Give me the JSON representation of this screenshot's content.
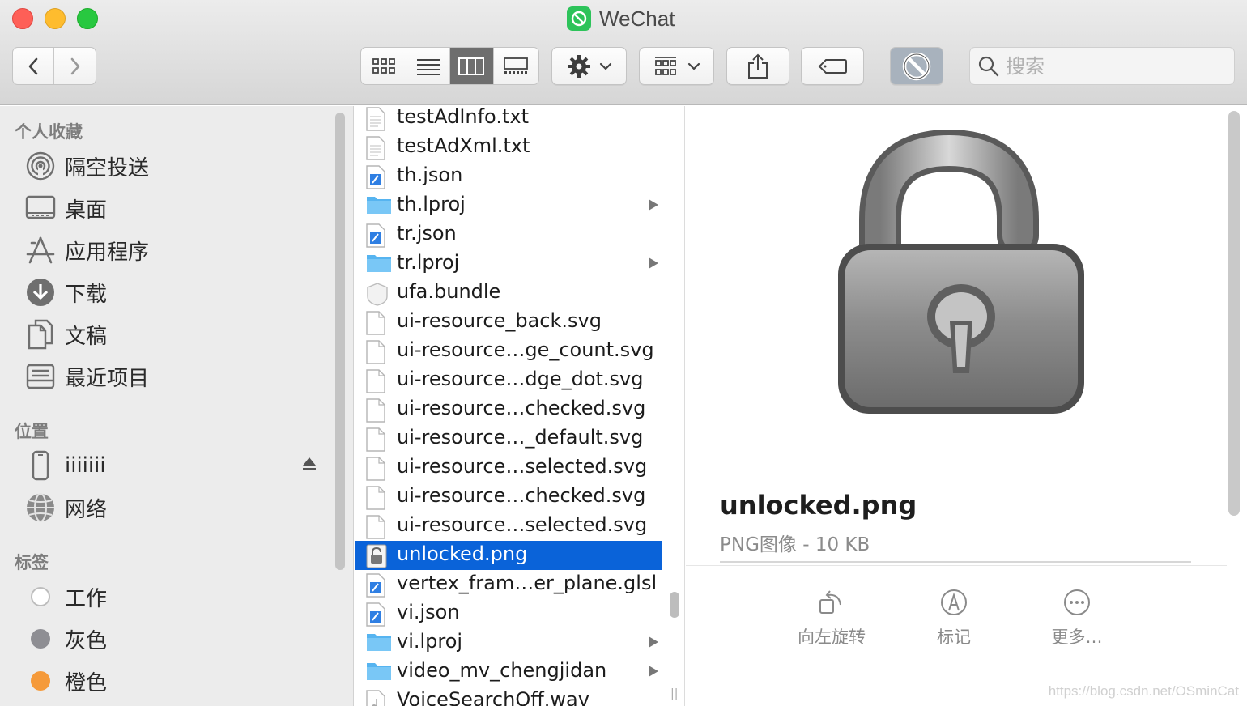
{
  "window": {
    "title": "WeChat",
    "accent": "#0a63d9"
  },
  "toolbar": {
    "back_icon": "chevron-left-icon",
    "forward_icon": "chevron-right-icon",
    "views": [
      "icon-view",
      "list-view",
      "column-view",
      "gallery-view"
    ],
    "active_view": "column-view",
    "search_placeholder": "搜索"
  },
  "sidebar": {
    "favorites_heading": "个人收藏",
    "favorites": [
      {
        "label": "隔空投送",
        "icon": "airdrop-icon"
      },
      {
        "label": "桌面",
        "icon": "desktop-icon"
      },
      {
        "label": "应用程序",
        "icon": "applications-icon"
      },
      {
        "label": "下载",
        "icon": "downloads-icon"
      },
      {
        "label": "文稿",
        "icon": "documents-icon"
      },
      {
        "label": "最近项目",
        "icon": "recents-icon"
      }
    ],
    "locations_heading": "位置",
    "locations": [
      {
        "label": "iiiiiii",
        "icon": "iphone-icon"
      },
      {
        "label": "网络",
        "icon": "network-icon"
      }
    ],
    "tags_heading": "标签",
    "tags": [
      {
        "label": "工作",
        "color": "#ffffff"
      },
      {
        "label": "灰色",
        "color": "#8e8e93"
      },
      {
        "label": "橙色",
        "color": "#f59a3a"
      }
    ]
  },
  "files": [
    {
      "name": "testAdInfo.txt",
      "icon": "text-file-icon",
      "folder": false
    },
    {
      "name": "testAdXml.txt",
      "icon": "text-file-icon",
      "folder": false
    },
    {
      "name": "th.json",
      "icon": "json-file-icon",
      "folder": false
    },
    {
      "name": "th.lproj",
      "icon": "folder-icon",
      "folder": true
    },
    {
      "name": "tr.json",
      "icon": "json-file-icon",
      "folder": false
    },
    {
      "name": "tr.lproj",
      "icon": "folder-icon",
      "folder": true
    },
    {
      "name": "ufa.bundle",
      "icon": "bundle-icon",
      "folder": false
    },
    {
      "name": "ui-resource_back.svg",
      "icon": "blank-file-icon",
      "folder": false
    },
    {
      "name": "ui-resource…ge_count.svg",
      "icon": "blank-file-icon",
      "folder": false
    },
    {
      "name": "ui-resource…dge_dot.svg",
      "icon": "blank-file-icon",
      "folder": false
    },
    {
      "name": "ui-resource…checked.svg",
      "icon": "blank-file-icon",
      "folder": false
    },
    {
      "name": "ui-resource…_default.svg",
      "icon": "blank-file-icon",
      "folder": false
    },
    {
      "name": "ui-resource…selected.svg",
      "icon": "blank-file-icon",
      "folder": false
    },
    {
      "name": "ui-resource…checked.svg",
      "icon": "blank-file-icon",
      "folder": false
    },
    {
      "name": "ui-resource…selected.svg",
      "icon": "blank-file-icon",
      "folder": false
    },
    {
      "name": "unlocked.png",
      "icon": "lock-image-icon",
      "folder": false,
      "selected": true
    },
    {
      "name": "vertex_fram…er_plane.glsl",
      "icon": "json-file-icon",
      "folder": false
    },
    {
      "name": "vi.json",
      "icon": "json-file-icon",
      "folder": false
    },
    {
      "name": "vi.lproj",
      "icon": "folder-icon",
      "folder": true
    },
    {
      "name": "video_mv_chengjidan",
      "icon": "folder-icon",
      "folder": true
    },
    {
      "name": "VoiceSearchOff.wav",
      "icon": "audio-file-icon",
      "folder": false
    }
  ],
  "preview": {
    "filename": "unlocked.png",
    "meta": "PNG图像 - 10 KB",
    "image_icon": "unlocked-padlock-icon",
    "actions": [
      {
        "label": "向左旋转",
        "icon": "rotate-left-icon"
      },
      {
        "label": "标记",
        "icon": "markup-icon"
      },
      {
        "label": "更多…",
        "icon": "more-icon"
      }
    ]
  },
  "watermark": "https://blog.csdn.net/OSminCat"
}
